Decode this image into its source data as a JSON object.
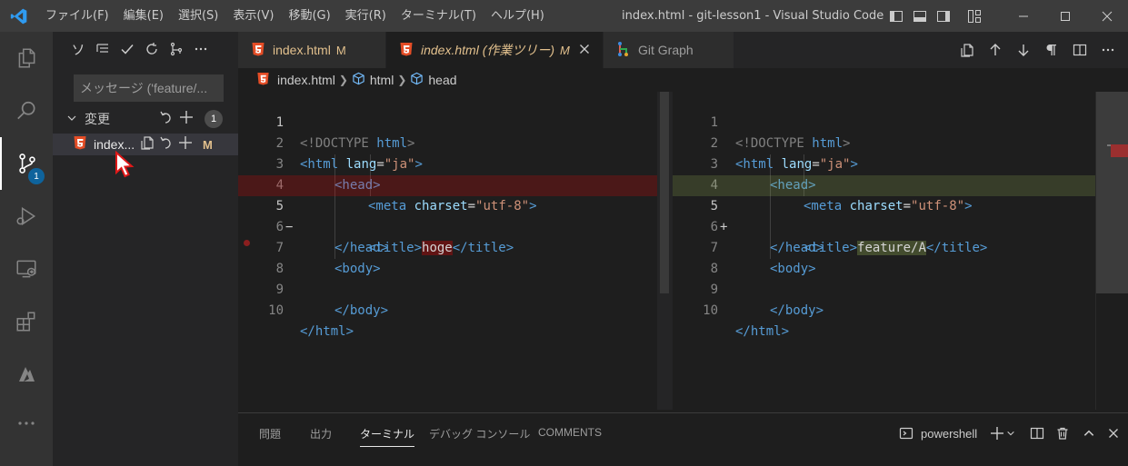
{
  "window": {
    "title": "index.html - git-lesson1 - Visual Studio Code",
    "menu": [
      "ファイル(F)",
      "編集(E)",
      "選択(S)",
      "表示(V)",
      "移動(G)",
      "実行(R)",
      "ターミナル(T)",
      "ヘルプ(H)"
    ]
  },
  "activity_bar": {
    "items": [
      "explorer-icon",
      "search-icon",
      "source-control-icon",
      "run-debug-icon",
      "remote-explorer-icon",
      "extensions-icon",
      "azure-icon",
      "more-icon"
    ],
    "active": "source-control-icon",
    "source_control_badge": "1"
  },
  "sidebar": {
    "toolbar": [
      "ソ",
      "view-as-tree-icon",
      "commit-check-icon",
      "refresh-icon",
      "branch-graph-icon",
      "more-actions-icon"
    ],
    "toolbar_label": "ソ",
    "commit_message_placeholder": "メッセージ ('feature/...",
    "changes_label": "変更",
    "changes_count": "1",
    "file": {
      "name": "index...",
      "status": "M"
    }
  },
  "tabs": [
    {
      "label": "index.html",
      "status": "M",
      "italic": false,
      "active": false
    },
    {
      "label": "index.html (作業ツリー)",
      "status": "M",
      "italic": true,
      "active": true
    },
    {
      "label": "Git Graph",
      "status": "",
      "italic": false,
      "active": false
    }
  ],
  "breadcrumb": [
    "index.html",
    "html",
    "head"
  ],
  "diff": {
    "left": {
      "lines": [
        {
          "n": "1",
          "mark": ""
        },
        {
          "n": "2",
          "mark": ""
        },
        {
          "n": "3",
          "mark": ""
        },
        {
          "n": "4",
          "mark": ""
        },
        {
          "n": "5",
          "mark": "−"
        },
        {
          "n": "6",
          "mark": ""
        },
        {
          "n": "7",
          "mark": ""
        },
        {
          "n": "8",
          "mark": ""
        },
        {
          "n": "9",
          "mark": ""
        },
        {
          "n": "10",
          "mark": ""
        }
      ],
      "changed_text": "hoge"
    },
    "right": {
      "lines": [
        {
          "n": "1",
          "mark": ""
        },
        {
          "n": "2",
          "mark": ""
        },
        {
          "n": "3",
          "mark": ""
        },
        {
          "n": "4",
          "mark": ""
        },
        {
          "n": "5",
          "mark": "+"
        },
        {
          "n": "6",
          "mark": ""
        },
        {
          "n": "7",
          "mark": ""
        },
        {
          "n": "8",
          "mark": ""
        },
        {
          "n": "9",
          "mark": ""
        },
        {
          "n": "10",
          "mark": ""
        }
      ],
      "changed_text": "feature/A"
    },
    "code": {
      "doctype_open": "<!DOCTYPE",
      "doctype_kw": "html",
      "html_tag": "<html",
      "lang_attr": "lang",
      "eq": "=",
      "lang_val": "\"ja\"",
      "gt": ">",
      "head_open": "<head>",
      "meta_tag": "<meta",
      "charset_attr": "charset",
      "charset_val": "\"utf-8\"",
      "title_open": "<title>",
      "title_close": "</title>",
      "head_close": "</head>",
      "body_open": "<body>",
      "body_close": "</body>",
      "html_close": "</html>"
    }
  },
  "panel": {
    "tabs": [
      "問題",
      "出力",
      "ターミナル",
      "デバッグ コンソール",
      "COMMENTS"
    ],
    "active_tab": "ターミナル",
    "terminal_name": "powershell"
  },
  "colors": {
    "accent": "#0e639c",
    "modified": "#e2c08d",
    "html_icon": "#e44d26",
    "deleted_bg": "#4b1818",
    "inserted_bg": "#373d29"
  }
}
